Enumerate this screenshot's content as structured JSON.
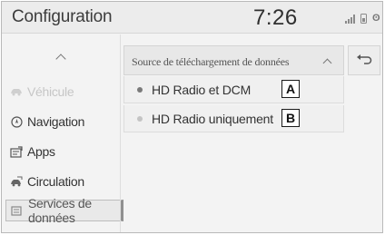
{
  "statusbar": {
    "title": "Configuration",
    "time": "7:26",
    "icons": [
      "signal-icon",
      "phone-battery-icon",
      "bluetooth-icon"
    ],
    "bluetooth_glyph": "ʘ"
  },
  "sidebar": {
    "up_icon": "chevron-up-icon",
    "items": [
      {
        "label": "Véhicule",
        "icon": "car-icon",
        "state": "disabled"
      },
      {
        "label": "Navigation",
        "icon": "compass-icon",
        "state": "normal"
      },
      {
        "label": "Apps",
        "icon": "apps-icon",
        "state": "normal"
      },
      {
        "label": "Circulation",
        "icon": "traffic-icon",
        "state": "normal"
      },
      {
        "label": "Services de données",
        "icon": "data-services-icon",
        "state": "selected"
      }
    ]
  },
  "panel": {
    "header_title": "Source de téléchargement de données",
    "collapse_icon": "chevron-up-icon",
    "back_icon": "back-arrow-icon",
    "options": [
      {
        "label": "HD Radio et DCM",
        "selected": true,
        "callout": "A"
      },
      {
        "label": "HD Radio uniquement",
        "selected": false,
        "callout": "B"
      }
    ]
  }
}
